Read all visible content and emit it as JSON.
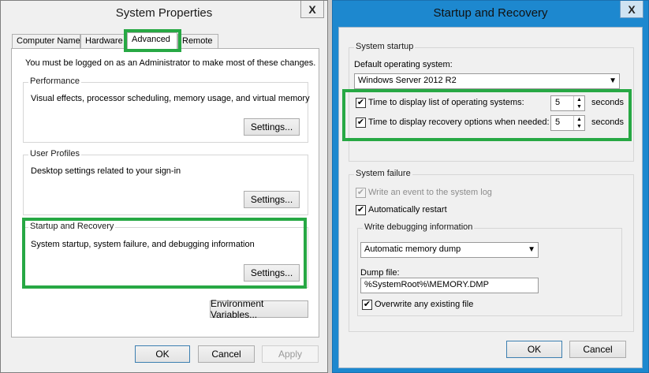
{
  "left_window": {
    "title": "System Properties",
    "close_label": "X",
    "tabs": [
      "Computer Name",
      "Hardware",
      "Advanced",
      "Remote"
    ],
    "admin_note": "You must be logged on as an Administrator to make most of these changes.",
    "performance": {
      "label": "Performance",
      "description": "Visual effects, processor scheduling, memory usage, and virtual memory",
      "button": "Settings..."
    },
    "user_profiles": {
      "label": "User Profiles",
      "description": "Desktop settings related to your sign-in",
      "button": "Settings..."
    },
    "startup_recovery": {
      "label": "Startup and Recovery",
      "description": "System startup, system failure, and debugging information",
      "button": "Settings..."
    },
    "env_button": "Environment Variables...",
    "ok": "OK",
    "cancel": "Cancel",
    "apply": "Apply"
  },
  "right_window": {
    "title": "Startup and Recovery",
    "close_label": "X",
    "system_startup": {
      "label": "System startup",
      "default_os_label": "Default operating system:",
      "default_os_value": "Windows Server 2012 R2",
      "time_list_label": "Time to display list of operating systems:",
      "time_list_value": "5",
      "time_recovery_label": "Time to display recovery options when needed:",
      "time_recovery_value": "5",
      "seconds": "seconds"
    },
    "system_failure": {
      "label": "System failure",
      "write_event_label": "Write an event to the system log",
      "auto_restart_label": "Automatically restart",
      "debug_group_label": "Write debugging information",
      "debug_type_value": "Automatic memory dump",
      "dump_file_label": "Dump file:",
      "dump_file_value": "%SystemRoot%\\MEMORY.DMP",
      "overwrite_label": "Overwrite any existing file"
    },
    "ok": "OK",
    "cancel": "Cancel"
  },
  "icons": {
    "check": "✔",
    "dropdown": "▼",
    "spin_up": "▲",
    "spin_down": "▼"
  },
  "colors": {
    "highlight": "#27a844",
    "right_window_frame": "#1d88cf"
  }
}
